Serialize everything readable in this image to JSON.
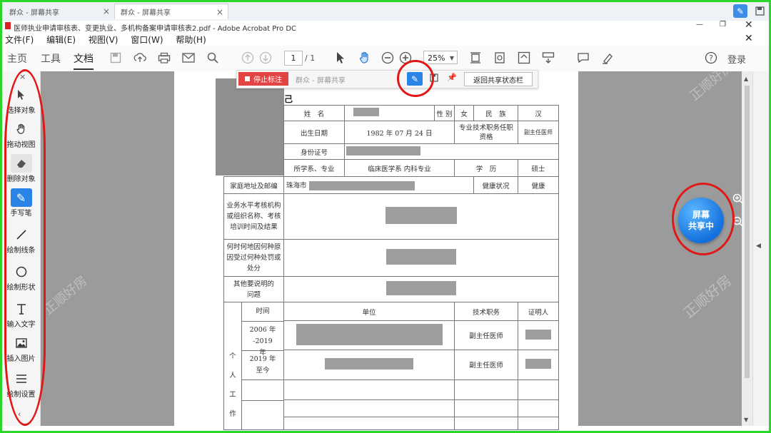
{
  "browser": {
    "tabs": [
      {
        "label": "群众 - 屏幕共享"
      },
      {
        "label": "群众 - 屏幕共享"
      }
    ]
  },
  "window": {
    "title": "医师执业申请审核表、变更执业、多机构备案申请审核表2.pdf - Adobe Acrobat Pro DC"
  },
  "menu": [
    "文件(F)",
    "编辑(E)",
    "视图(V)",
    "窗口(W)",
    "帮助(H)"
  ],
  "toolbar": {
    "home": "主页",
    "tools": "工具",
    "document": "文档",
    "page_current": "1",
    "page_total": "/ 1",
    "zoom": "25%",
    "login": "登录"
  },
  "sharebar": {
    "stop_label": "停止标注",
    "placeholder": "群众 - 屏幕共享",
    "return_label": "返回共享状态栏"
  },
  "left_tools": [
    {
      "label": "选择对象",
      "icon": "cursor-icon"
    },
    {
      "label": "拖动视图",
      "icon": "hand-icon"
    },
    {
      "label": "删除对象",
      "icon": "eraser-icon"
    },
    {
      "label": "手写笔",
      "icon": "pen-icon"
    },
    {
      "label": "绘制线条",
      "icon": "line-icon"
    },
    {
      "label": "绘制形状",
      "icon": "circle-icon"
    },
    {
      "label": "输入文字",
      "icon": "text-icon"
    },
    {
      "label": "插入图片",
      "icon": "image-icon"
    },
    {
      "label": "绘制设置",
      "icon": "menu-icon"
    }
  ],
  "share_status": {
    "line1": "屏幕",
    "line2": "共享中"
  },
  "form": {
    "title_fragment": "己",
    "r1": {
      "name_label": "姓　名",
      "gender_label": "性 别",
      "gender": "女",
      "ethnic_label": "民　族",
      "ethnic": "汉"
    },
    "r2": {
      "dob_label": "出生日期",
      "dob": "1982 年 07 月 24 日",
      "title_label": "专业技术职务任职资格",
      "title_value": "副主任医师"
    },
    "r3": {
      "id_label": "身份证号"
    },
    "r4": {
      "school_label": "所学系、专业",
      "school": "临床医学系 内科专业",
      "degree_label": "学　历",
      "degree": "硕士"
    },
    "r5": {
      "addr_label": "家庭地址及邮编",
      "addr": "珠海市",
      "health_label": "健康状况",
      "health": "健康"
    },
    "r6": {
      "label": "业务水平考核机构或组织名称、考核培训时间及结果"
    },
    "r7": {
      "label": "何时何地因何种原因受过何种处罚或处分"
    },
    "r8": {
      "label": "其他要说明的问题"
    },
    "work": {
      "side_label": [
        "个",
        "人",
        "工",
        "作"
      ],
      "col_time": "时间",
      "col_unit": "单位",
      "col_title": "技术职务",
      "col_witness": "证明人",
      "rows": [
        {
          "time": "2006 年 -2019 年",
          "title": "副主任医师"
        },
        {
          "time": "2019 年至今",
          "title": "副主任医师"
        }
      ]
    }
  },
  "watermark": "正顺好房",
  "colors": {
    "frame": "#2bd62b",
    "annotation": "#e01818",
    "share": "#1a7fe8",
    "stop": "#e24444"
  }
}
